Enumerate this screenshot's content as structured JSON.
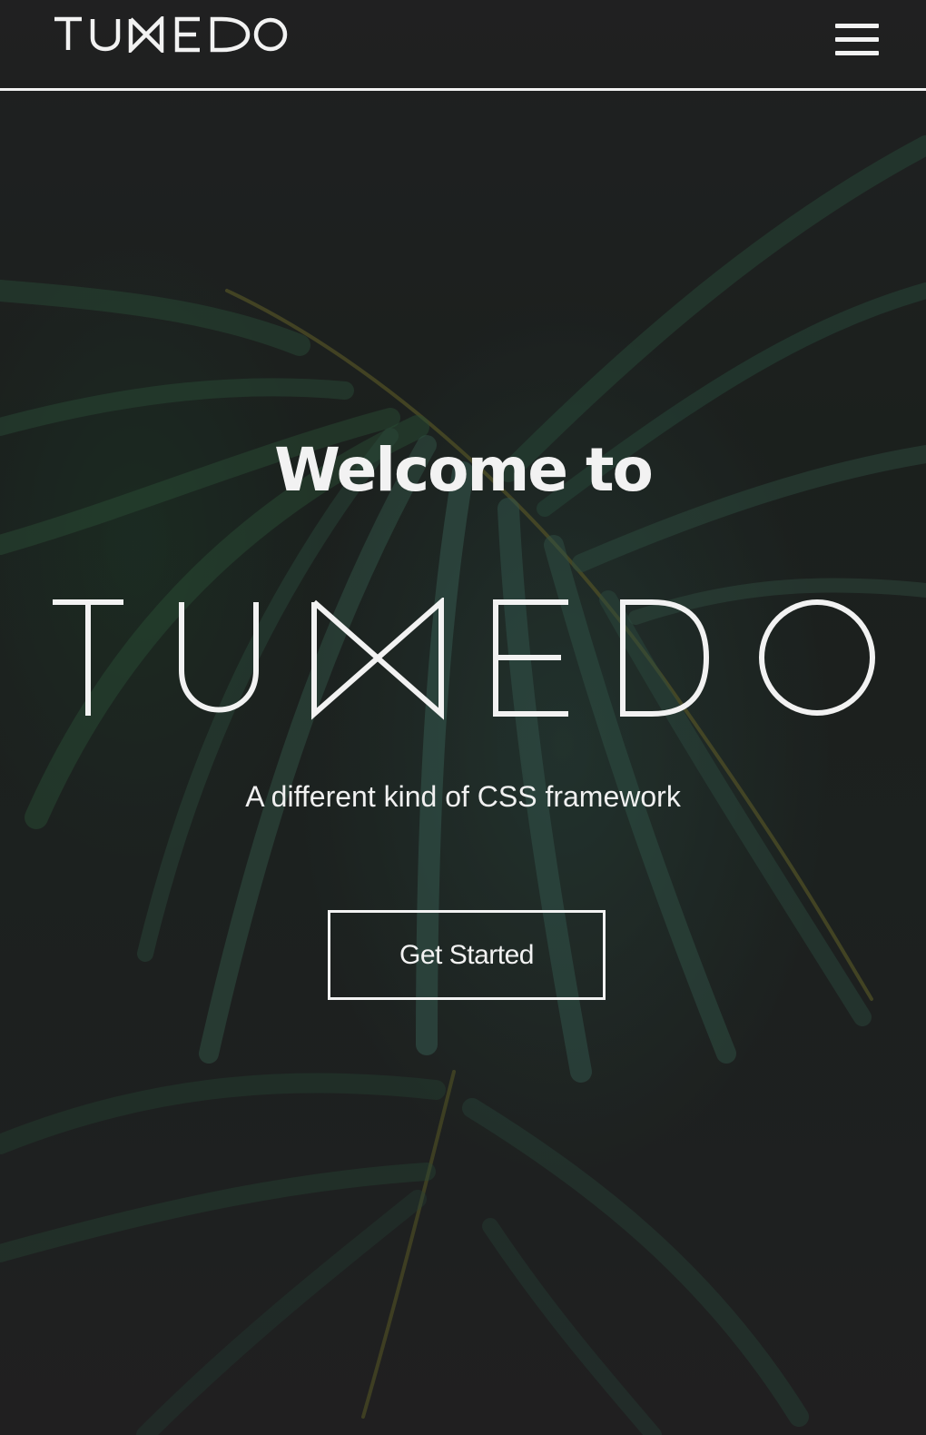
{
  "navbar": {
    "brand": "TUXEDO",
    "menu_icon": "hamburger-menu-icon"
  },
  "hero": {
    "title": "Welcome to",
    "logo_text": "TUXEDO",
    "subtitle": "A different kind of CSS framework",
    "cta_label": "Get Started",
    "background": "palm-leaf-photo"
  },
  "colors": {
    "text": "#f2f2f2",
    "background": "#242526",
    "foliage": "#2f5e44"
  }
}
